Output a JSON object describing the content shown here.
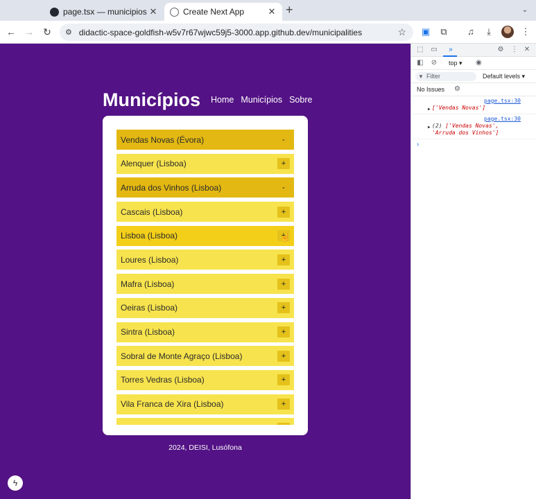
{
  "browser": {
    "tabs": [
      {
        "title": "page.tsx — municipios [Code",
        "icon": "github-icon"
      },
      {
        "title": "Create Next App",
        "icon": "globe-icon"
      }
    ],
    "new_tab": "+",
    "url": "didactic-space-goldfish-w5v7r67wjwc59j5-3000.app.github.dev/municipalities"
  },
  "page": {
    "title": "Municípios",
    "nav": [
      "Home",
      "Municípios",
      "Sobre"
    ],
    "municipalities": [
      {
        "label": "Vendas Novas (Évora)",
        "toggle": "-",
        "state": "expanded"
      },
      {
        "label": "Alenquer (Lisboa)",
        "toggle": "+",
        "state": "collapsed"
      },
      {
        "label": "Arruda dos Vinhos (Lisboa)",
        "toggle": "-",
        "state": "expanded"
      },
      {
        "label": "Cascais (Lisboa)",
        "toggle": "+",
        "state": "collapsed"
      },
      {
        "label": "Lisboa (Lisboa)",
        "toggle": "+",
        "state": "hover"
      },
      {
        "label": "Loures (Lisboa)",
        "toggle": "+",
        "state": "collapsed"
      },
      {
        "label": "Mafra (Lisboa)",
        "toggle": "+",
        "state": "collapsed"
      },
      {
        "label": "Oeiras (Lisboa)",
        "toggle": "+",
        "state": "collapsed"
      },
      {
        "label": "Sintra (Lisboa)",
        "toggle": "+",
        "state": "collapsed"
      },
      {
        "label": "Sobral de Monte Agraço (Lisboa)",
        "toggle": "+",
        "state": "collapsed"
      },
      {
        "label": "Torres Vedras (Lisboa)",
        "toggle": "+",
        "state": "collapsed"
      },
      {
        "label": "Vila Franca de Xira (Lisboa)",
        "toggle": "+",
        "state": "collapsed"
      },
      {
        "label": "",
        "toggle": "+",
        "state": "collapsed"
      }
    ],
    "footer": "2024, DEISI, Lusófona",
    "colors": {
      "background": "#531285",
      "item": "#f7e34d",
      "item_expanded": "#e3b812",
      "item_hover": "#f3cf1a"
    }
  },
  "devtools": {
    "context": "top ▾",
    "filter_placeholder": "Filter",
    "levels": "Default levels ▾",
    "issues": "No Issues",
    "logs": [
      {
        "source": "page.tsx:30",
        "count": "",
        "text": "['Vendas Novas']"
      },
      {
        "source": "page.tsx:30",
        "count": "(2) ",
        "text": "['Vendas Novas', 'Arruda dos Vinhos']"
      }
    ],
    "prompt": "›"
  }
}
